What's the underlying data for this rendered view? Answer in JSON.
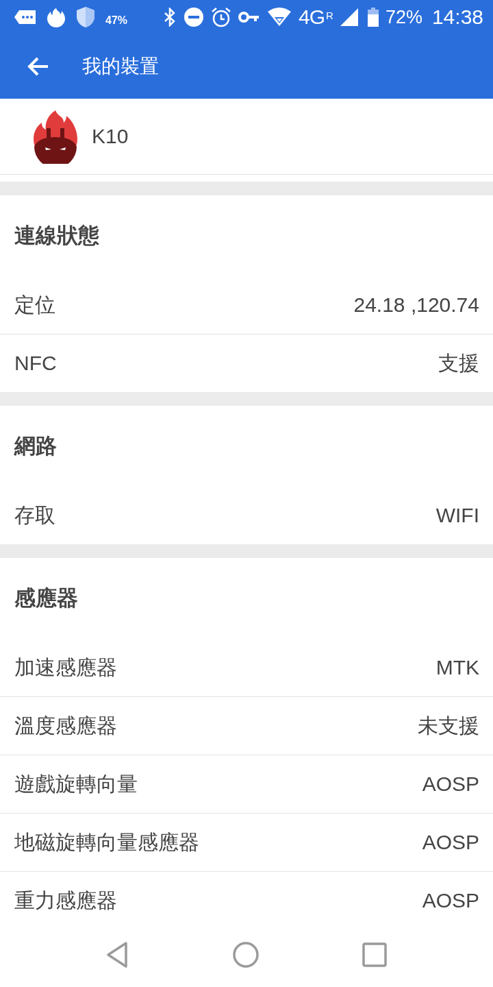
{
  "status_bar": {
    "battery_saver": "47%",
    "network": "4G",
    "roaming": "R",
    "battery": "72%",
    "time": "14:38"
  },
  "app_bar": {
    "title": "我的裝置"
  },
  "device": {
    "name": "K10"
  },
  "sections": [
    {
      "title": "連線狀態",
      "rows": [
        {
          "label": "定位",
          "value": "24.18 ,120.74"
        },
        {
          "label": "NFC",
          "value": "支援"
        }
      ]
    },
    {
      "title": "網路",
      "rows": [
        {
          "label": "存取",
          "value": "WIFI"
        }
      ]
    },
    {
      "title": "感應器",
      "rows": [
        {
          "label": "加速感應器",
          "value": "MTK"
        },
        {
          "label": "溫度感應器",
          "value": "未支援"
        },
        {
          "label": "遊戲旋轉向量",
          "value": "AOSP"
        },
        {
          "label": "地磁旋轉向量感應器",
          "value": "AOSP"
        },
        {
          "label": "重力感應器",
          "value": "AOSP"
        }
      ]
    }
  ]
}
